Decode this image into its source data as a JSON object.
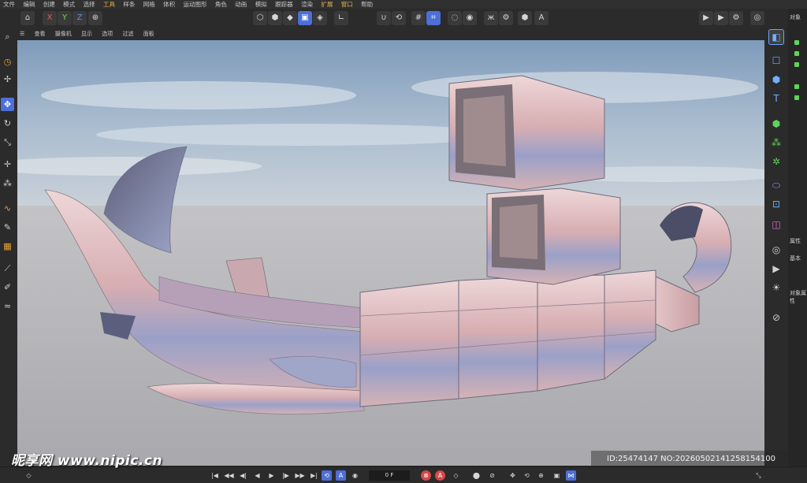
{
  "menu": [
    "文件",
    "编辑",
    "创建",
    "模式",
    "选择",
    "工具",
    "样条",
    "网格",
    "体积",
    "运动图形",
    "角色",
    "动画",
    "模拟",
    "跟踪器",
    "渲染",
    "扩展",
    "窗口",
    "帮助"
  ],
  "axis": {
    "x": "X",
    "y": "Y",
    "z": "Z"
  },
  "viewport_menu": [
    "查看",
    "摄像机",
    "显示",
    "选项",
    "过滤",
    "面板"
  ],
  "objects_panel": {
    "title": "对象",
    "attributes": "属性",
    "basic": "基本",
    "object_label": "对象属性"
  },
  "timeline": {
    "frame": "0 F"
  },
  "watermark": {
    "left": "昵享网 www.nipic.cn",
    "right": "ID:25474147 NO:20260502141258154100"
  },
  "colors": {
    "accent": "#4d6fd6",
    "model": "#d9b6b8",
    "sky_top": "#8aa3bf",
    "floor": "#b8b8bb"
  },
  "icons": {
    "left": [
      "search-icon",
      "camera-icon",
      "transform-icon",
      "move-icon",
      "rotate-icon",
      "scale-icon",
      "axis-icon",
      "snap-icon",
      "spline-icon",
      "pen-icon",
      "brush-icon",
      "knife-icon",
      "paint-icon",
      "smooth-icon"
    ],
    "right": [
      "null-icon",
      "cube-icon",
      "text-icon",
      "green-cube-icon",
      "cloner-icon",
      "gear-icon",
      "capsule-icon",
      "deformer-icon",
      "field-icon",
      "environment-icon",
      "camera-icon",
      "light-icon",
      "tag-icon"
    ]
  }
}
